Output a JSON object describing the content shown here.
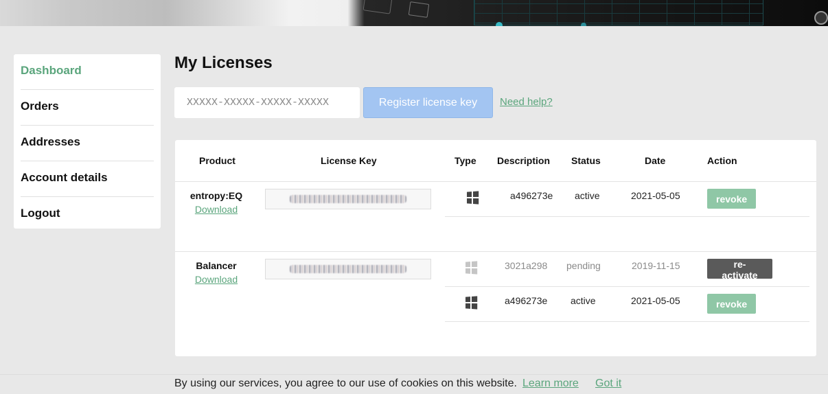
{
  "sidebar": {
    "items": [
      {
        "label": "Dashboard",
        "active": true
      },
      {
        "label": "Orders"
      },
      {
        "label": "Addresses"
      },
      {
        "label": "Account details"
      },
      {
        "label": "Logout"
      }
    ]
  },
  "page": {
    "title": "My Licenses"
  },
  "register": {
    "placeholder": "XXXXX-XXXXX-XXXXX-XXXXX",
    "button_label": "Register license key",
    "help_label": "Need help?"
  },
  "table": {
    "headers": {
      "product": "Product",
      "license_key": "License Key",
      "type": "Type",
      "description": "Description",
      "status": "Status",
      "date": "Date",
      "action": "Action"
    },
    "products": [
      {
        "name": "entropy:EQ",
        "download_label": "Download",
        "activations": [
          {
            "type_icon": "windows-icon",
            "description": "a496273e",
            "status": "active",
            "date": "2021-05-05",
            "action": "revoke"
          }
        ]
      },
      {
        "name": "Balancer",
        "download_label": "Download",
        "activations": [
          {
            "type_icon": "windows-icon",
            "description": "3021a298",
            "status": "pending",
            "date": "2019-11-15",
            "action": "re-activate"
          },
          {
            "type_icon": "windows-icon",
            "description": "a496273e",
            "status": "active",
            "date": "2021-05-05",
            "action": "revoke"
          }
        ]
      }
    ]
  },
  "cookie": {
    "text": "By using our services, you agree to our use of cookies on this website.",
    "learn_more": "Learn more",
    "got_it": "Got it"
  },
  "colors": {
    "accent": "#5aa57c",
    "register_button": "#a3c5f2",
    "revoke_button": "#8fc7a6",
    "reactivate_button": "#5a5a5a"
  }
}
